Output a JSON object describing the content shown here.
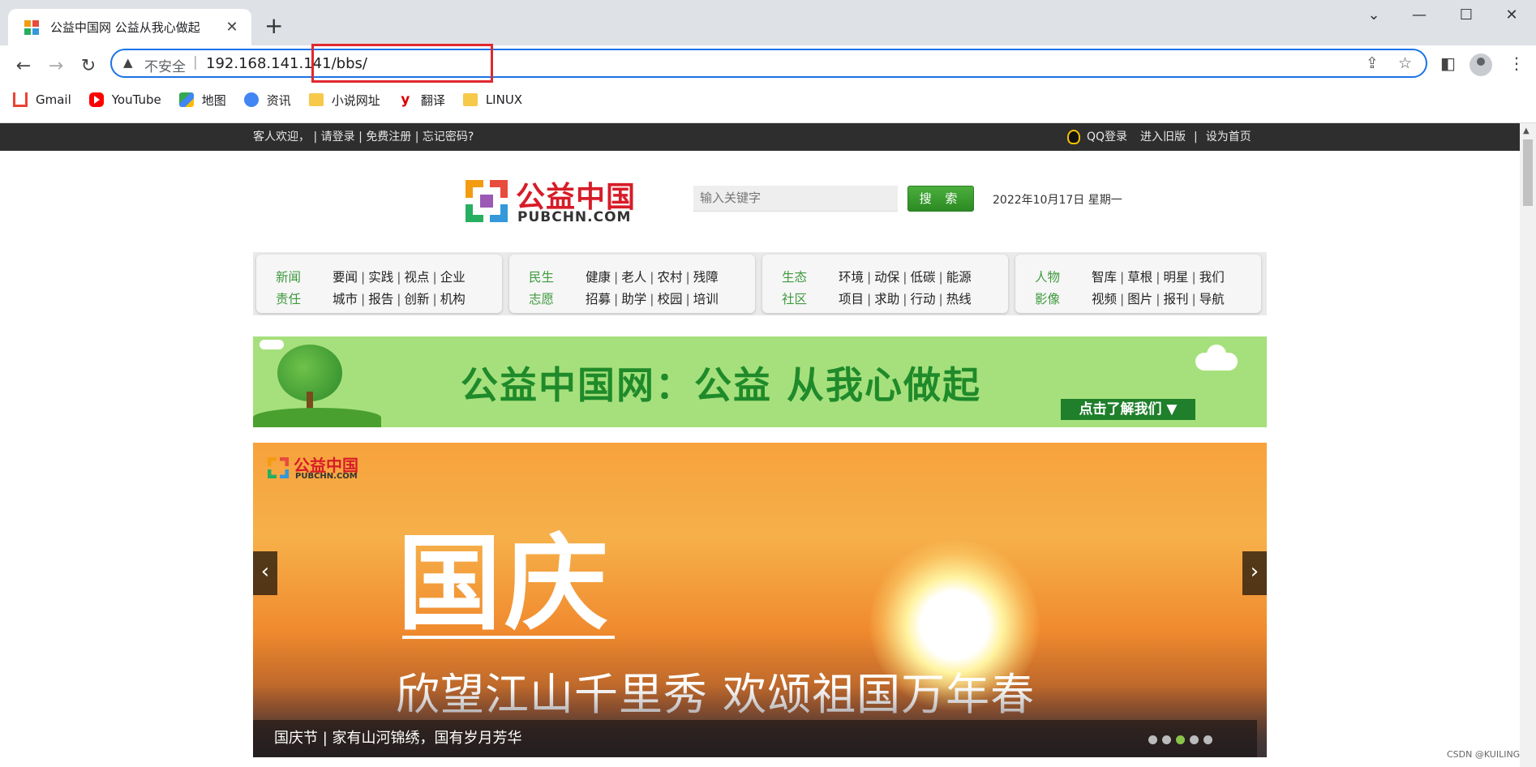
{
  "browser": {
    "tab_title": "公益中国网 公益从我心做起",
    "tab_close": "✕",
    "new_tab": "+",
    "window_controls": {
      "list": "⌄",
      "minimize": "—",
      "maximize": "☐",
      "close": "✕"
    },
    "nav": {
      "back": "←",
      "forward": "→",
      "reload": "↻"
    },
    "address": {
      "warning_icon": "▲",
      "security_label": "不安全",
      "separator": "|",
      "url": "192.168.141.141/bbs/"
    },
    "toolbar_icons": [
      "share-icon",
      "star-icon",
      "side-panel-icon",
      "profile-icon",
      "menu-icon"
    ],
    "bookmarks": [
      {
        "label": "Gmail",
        "icon": "gmail-icon"
      },
      {
        "label": "YouTube",
        "icon": "youtube-icon"
      },
      {
        "label": "地图",
        "icon": "maps-icon"
      },
      {
        "label": "资讯",
        "icon": "news-icon"
      },
      {
        "label": "小说网址",
        "icon": "folder-icon"
      },
      {
        "label": "翻译",
        "icon": "translate-icon",
        "glyph": "y"
      },
      {
        "label": "LINUX",
        "icon": "folder-icon"
      }
    ]
  },
  "page": {
    "topbar": {
      "welcome": "客人欢迎，",
      "login": "请登录",
      "register": "免费注册",
      "forgot": "忘记密码?",
      "qq_login": "QQ登录",
      "old_version": "进入旧版",
      "set_home": "设为首页"
    },
    "logo": {
      "cn": "公益中国",
      "en": "PUBCHN.COM"
    },
    "search": {
      "placeholder": "输入关键字",
      "button": "搜 索"
    },
    "date": "2022年10月17日 星期一",
    "nav_groups": [
      {
        "cats": [
          "新闻",
          "责任"
        ],
        "row1": [
          "要闻",
          "实践",
          "视点",
          "企业"
        ],
        "row2": [
          "城市",
          "报告",
          "创新",
          "机构"
        ]
      },
      {
        "cats": [
          "民生",
          "志愿"
        ],
        "row1": [
          "健康",
          "老人",
          "农村",
          "残障"
        ],
        "row2": [
          "招募",
          "助学",
          "校园",
          "培训"
        ]
      },
      {
        "cats": [
          "生态",
          "社区"
        ],
        "row1": [
          "环境",
          "动保",
          "低碳",
          "能源"
        ],
        "row2": [
          "项目",
          "求助",
          "行动",
          "热线"
        ]
      },
      {
        "cats": [
          "人物",
          "影像"
        ],
        "row1": [
          "智库",
          "草根",
          "明星",
          "我们"
        ],
        "row2": [
          "视频",
          "图片",
          "报刊",
          "导航"
        ]
      }
    ],
    "banner": {
      "slogan": "公益中国网：公益 从我心做起",
      "more": "点击了解我们 ▼"
    },
    "slider": {
      "logo_cn": "公益中国",
      "logo_en": "PUBCHN.COM",
      "big_title": "国庆",
      "subtitle": "欣望江山千里秀 欢颂祖国万年春",
      "caption": "国庆节 | 家有山河锦绣，国有岁月芳华",
      "prev": "‹",
      "next": "›",
      "dots": 5,
      "active_dot": 3
    },
    "watermark": "CSDN @KUILING"
  },
  "colors": {
    "accent": "#1a73e8",
    "highlight": "#e0282f",
    "brand_red": "#d71c28",
    "green": "#3f9a3f"
  }
}
